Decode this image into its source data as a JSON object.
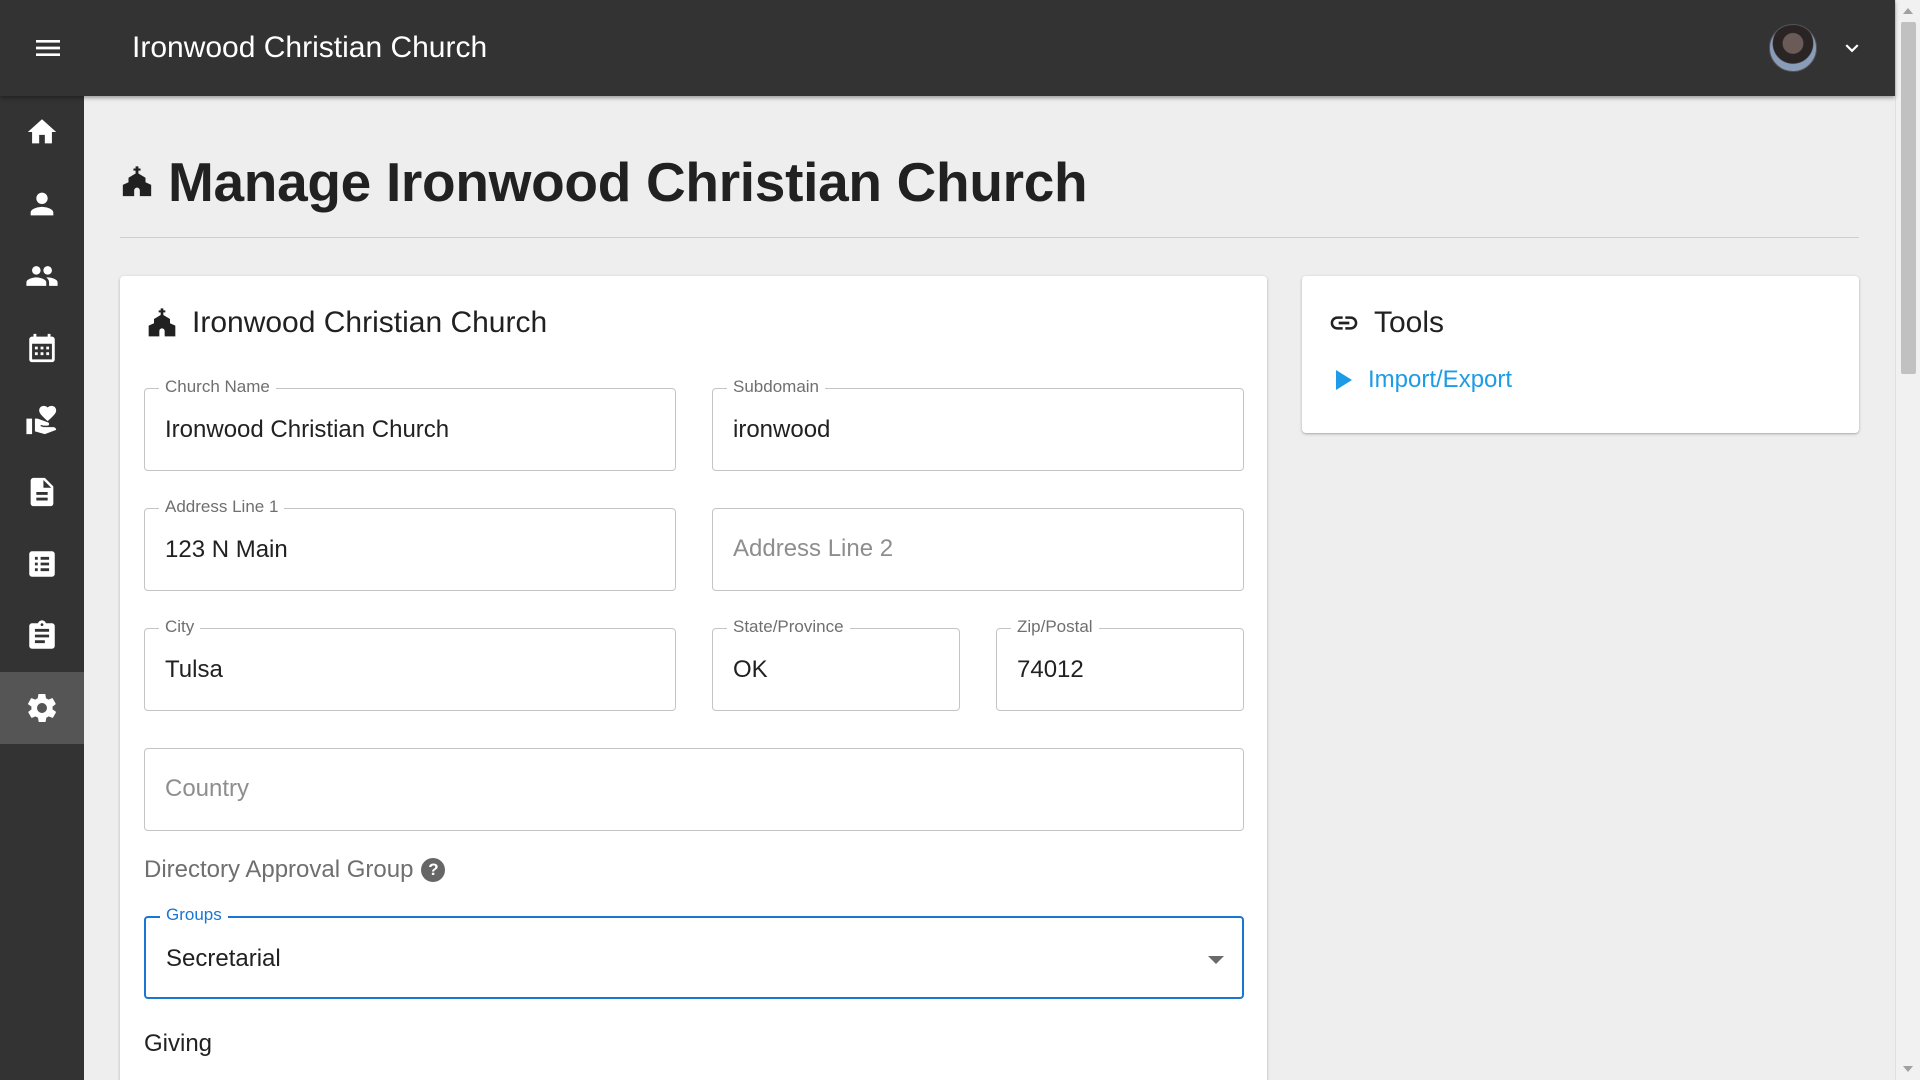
{
  "app": {
    "title": "Ironwood Christian Church"
  },
  "header": {
    "menu_icon": "hamburger-menu-icon",
    "avatar_icon": "user-avatar",
    "dropdown_icon": "chevron-down-icon"
  },
  "sidebar": {
    "items": [
      {
        "icon": "home-icon",
        "active": false
      },
      {
        "icon": "person-icon",
        "active": false
      },
      {
        "icon": "people-icon",
        "active": false
      },
      {
        "icon": "calendar-icon",
        "active": false
      },
      {
        "icon": "donation-hand-icon",
        "active": false
      },
      {
        "icon": "document-icon",
        "active": false
      },
      {
        "icon": "list-icon",
        "active": false
      },
      {
        "icon": "clipboard-icon",
        "active": false
      },
      {
        "icon": "gear-icon",
        "active": true
      }
    ]
  },
  "page": {
    "title": "Manage Ironwood Christian Church",
    "icon": "church-icon"
  },
  "church_card": {
    "title": "Ironwood Christian Church",
    "icon": "church-icon",
    "fields": {
      "church_name": {
        "label": "Church Name",
        "value": "Ironwood Christian Church"
      },
      "subdomain": {
        "label": "Subdomain",
        "value": "ironwood"
      },
      "address1": {
        "label": "Address Line 1",
        "value": "123 N Main"
      },
      "address2": {
        "placeholder": "Address Line 2"
      },
      "city": {
        "label": "City",
        "value": "Tulsa"
      },
      "state": {
        "label": "State/Province",
        "value": "OK"
      },
      "zip": {
        "label": "Zip/Postal",
        "value": "74012"
      },
      "country": {
        "placeholder": "Country"
      }
    },
    "directory_approval": {
      "label": "Directory Approval Group",
      "help_icon": "help-circle-icon",
      "help_glyph": "?",
      "groups": {
        "label": "Groups",
        "value": "Secretarial"
      }
    },
    "giving_label": "Giving"
  },
  "tools_card": {
    "title": "Tools",
    "icon": "link-icon",
    "links": [
      {
        "label": "Import/Export",
        "icon": "play-arrow-icon"
      }
    ]
  },
  "colors": {
    "appbar": "#333333",
    "background": "#eeeeee",
    "focus": "#1976d2",
    "link": "#1e9be6"
  }
}
